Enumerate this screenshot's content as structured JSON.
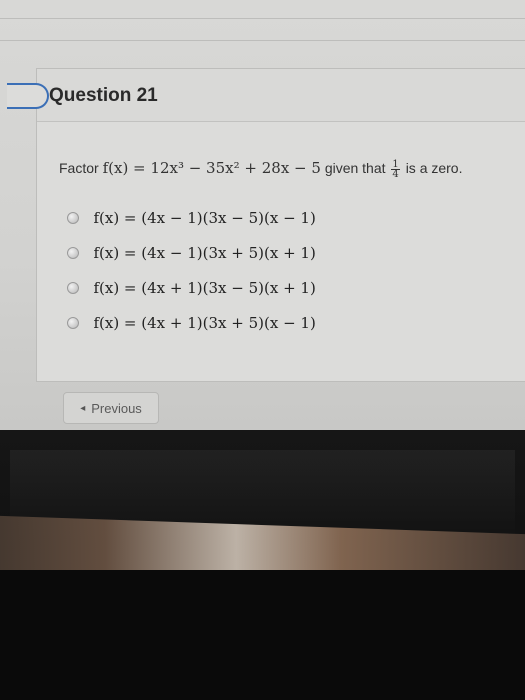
{
  "question": {
    "title": "Question 21",
    "prompt_prefix": "Factor",
    "function": "f(x) = 12x³ − 35x² + 28x − 5",
    "given_text": "given that",
    "fraction_num": "1",
    "fraction_den": "4",
    "suffix": "is a zero."
  },
  "options": [
    "f(x) = (4x − 1)(3x − 5)(x − 1)",
    "f(x) = (4x − 1)(3x + 5)(x + 1)",
    "f(x) = (4x + 1)(3x − 5)(x + 1)",
    "f(x) = (4x + 1)(3x + 5)(x − 1)"
  ],
  "nav": {
    "previous_label": "Previous"
  }
}
